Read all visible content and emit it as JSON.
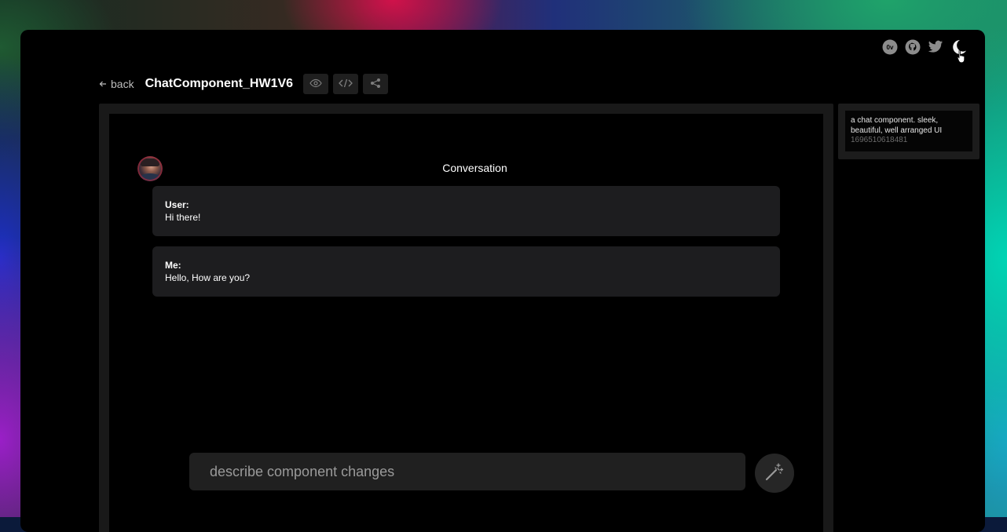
{
  "header": {
    "back_label": "back",
    "component_title": "ChatComponent_HW1V6"
  },
  "toolbar": {
    "icons": [
      "eye-icon",
      "code-icon",
      "share-icon"
    ]
  },
  "top_right_icons": [
    "dribbble-style-icon",
    "github-icon",
    "twitter-icon",
    "theme-toggle-icon"
  ],
  "chat": {
    "title": "Conversation",
    "messages": [
      {
        "sender": "User:",
        "text": "Hi there!"
      },
      {
        "sender": "Me:",
        "text": "Hello, How are you?"
      }
    ]
  },
  "prompt_input": {
    "placeholder": "describe component changes"
  },
  "history": {
    "items": [
      {
        "description": "a chat component. sleek, beautiful, well arranged UI",
        "timestamp": "1696510618481"
      }
    ]
  },
  "colors": {
    "panel": "#191919",
    "bubble": "#1d1d1f",
    "input": "#202020"
  }
}
